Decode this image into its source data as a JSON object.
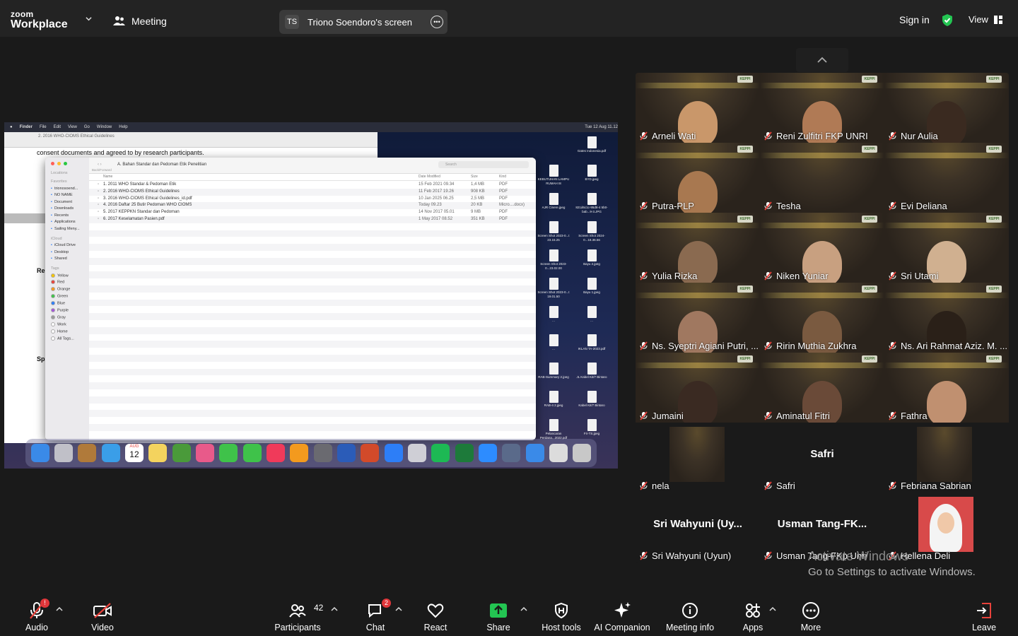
{
  "app": {
    "logo_line1": "zoom",
    "logo_line2": "Workplace",
    "meeting_label": "Meeting"
  },
  "share": {
    "initials": "TS",
    "label": "Triono Soendoro's screen"
  },
  "topright": {
    "signin": "Sign in",
    "view": "View"
  },
  "shared_screen": {
    "menubar": [
      "Finder",
      "File",
      "Edit",
      "View",
      "Go",
      "Window",
      "Help"
    ],
    "clock": "Tue 12 Aug 11.12",
    "pdf_title": "2. 2016 WHO-CIOMS Ethical Guidelines",
    "pdf_line": "consent documents and agreed to by research participants.",
    "pdf_snippets": [
      "Re",
      "Sp"
    ],
    "finder_title": "A. Bahan Standar dan Pedoman Etik Penelitian",
    "finder_nav": "Back/Forward",
    "finder_search": "Search",
    "columns": {
      "name": "Name",
      "date": "Date Modified",
      "size": "Size",
      "kind": "Kind"
    },
    "files": [
      {
        "name": "1. 2011 WHO Standar & Pedoman Etik",
        "date": "15 Feb 2021 09.34",
        "size": "1,4 MB",
        "kind": "PDF"
      },
      {
        "name": "2. 2016 WHO-CIOMS Ethical Guidelines",
        "date": "11 Feb 2017 19.26",
        "size": "908 KB",
        "kind": "PDF"
      },
      {
        "name": "3. 2016 WHO-CIOMS Ethical Guidelines_id.pdf",
        "date": "10 Jan 2025 06.25",
        "size": "2,5 MB",
        "kind": "PDF"
      },
      {
        "name": "4. 2016 Daftar 25 Butir Pedoman WHO CIOMS",
        "date": "Today 09.23",
        "size": "20 KB",
        "kind": "Micro....docx)"
      },
      {
        "name": "5. 2017 KEPPKN Standar dan Pedoman",
        "date": "14 Nov 2017 05.01",
        "size": "9 MB",
        "kind": "PDF"
      },
      {
        "name": "6. 2017 Keselamatan Pasien.pdf",
        "date": "1 May 2017 08.52",
        "size": "351 KB",
        "kind": "PDF"
      }
    ],
    "sidebar": {
      "locations": "Locations",
      "favorites": "Favorites",
      "fav_items": [
        "trionosoend...",
        "NO NAME",
        "Document",
        "Downloads",
        "Recents",
        "Applications",
        "Sailing Meny..."
      ],
      "icloud": "iCloud",
      "icloud_items": [
        "iCloud Drive",
        "Desktop",
        "Shared"
      ],
      "tags": "Tags",
      "tag_items": [
        "Yellow",
        "Red",
        "Orange",
        "Green",
        "Blue",
        "Purple",
        "Gray",
        "Work",
        "Home",
        "All Tags..."
      ],
      "tag_colors": [
        "#f5c400",
        "#e8423b",
        "#f39a1e",
        "#3fc24a",
        "#2d7ef7",
        "#a456d8",
        "#9a9a9a",
        "#ffffff",
        "#ffffff",
        "#ffffff"
      ]
    },
    "desktop_icons": [
      "Gates Indonesia.pdf",
      "KEBUTUHAN LAMPU RUMAH I8",
      "BYD.jpeg",
      "AJR Cinere.jpeg",
      "821d6c1c-95d8-4 5b0-bab...9-3.JPG",
      "Screen Shot 2023-0...t 23.15.25",
      "Screen Shot 2024-0...18.36.56",
      "Screen Shot 2023-0...23.02.00",
      "Bayu 2.jpeg",
      "Screen Shot 2023-0...t 19.01.50",
      "Bayu 1.jpeg",
      "...",
      "...",
      "...",
      "IKLAN TA-2023.pdf",
      "RAB-Summary 2.jpeg",
      "JL Kabel Kit/7 Bintaro",
      "RAB-4 2.jpeg",
      "Kabel Kit/7 Bintaro",
      "Pelancaran Perdana...2022.pdf",
      "Fri-TS.jpeg"
    ],
    "dock_calendar": {
      "month": "AUG",
      "day": "12"
    }
  },
  "participants": [
    {
      "name": "Arneli Wati",
      "video": true
    },
    {
      "name": "Reni Zulfitri FKP UNRI",
      "video": true
    },
    {
      "name": "Nur Aulia",
      "video": true
    },
    {
      "name": "Putra-PLP",
      "video": true
    },
    {
      "name": "Tesha",
      "video": true
    },
    {
      "name": "Evi Deliana",
      "video": true
    },
    {
      "name": "Yulia Rizka",
      "video": true
    },
    {
      "name": "Niken Yuniar",
      "video": true
    },
    {
      "name": "Sri Utami",
      "video": true
    },
    {
      "name": "Ns. Syeptri Agiani Putri, ...",
      "video": true
    },
    {
      "name": "Ririn Muthia Zukhra",
      "video": true
    },
    {
      "name": "Ns. Ari Rahmat Aziz. M. ...",
      "video": true
    },
    {
      "name": "Jumaini",
      "video": true
    },
    {
      "name": "Aminatul Fitri",
      "video": true
    },
    {
      "name": "Fathra",
      "video": true
    },
    {
      "name": "nela",
      "video": true
    },
    {
      "name": "Safri",
      "video": false,
      "display": "Safri"
    },
    {
      "name": "Febriana Sabrian",
      "video": true
    },
    {
      "name": "Sri Wahyuni (Uyun)",
      "video": false,
      "display": "Sri Wahyuni (Uy..."
    },
    {
      "name": "Usman Tang-FKp Unri",
      "video": false,
      "display": "Usman Tang-FK..."
    },
    {
      "name": "Hellena Deli",
      "video": true
    }
  ],
  "watermark": {
    "line1": "Activate Windows",
    "line2": "Go to Settings to activate Windows."
  },
  "toolbar": {
    "audio": "Audio",
    "audio_badge": "!",
    "video": "Video",
    "participants": "Participants",
    "participants_count": "42",
    "chat": "Chat",
    "chat_badge": "2",
    "react": "React",
    "share": "Share",
    "host_tools": "Host tools",
    "ai_companion": "AI Companion",
    "meeting_info": "Meeting info",
    "apps": "Apps",
    "more": "More",
    "leave": "Leave"
  },
  "colors": {
    "accent_green": "#23c552",
    "leave_red": "#e8423b",
    "muted_red": "#e8423b",
    "topbar": "#232323",
    "bg": "#1a1a1a"
  }
}
